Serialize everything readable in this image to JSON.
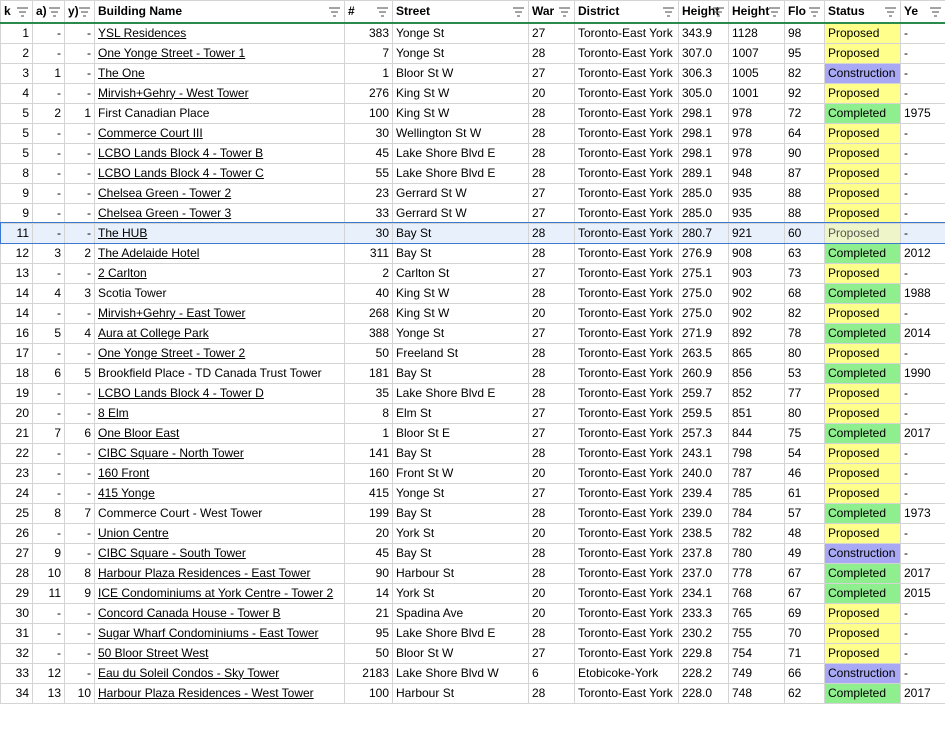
{
  "columns": [
    {
      "key": "rank",
      "label": "k"
    },
    {
      "key": "rank_a",
      "label": "a)"
    },
    {
      "key": "rank_b",
      "label": "y)"
    },
    {
      "key": "name",
      "label": "Building Name"
    },
    {
      "key": "num",
      "label": "#"
    },
    {
      "key": "street",
      "label": "Street"
    },
    {
      "key": "ward",
      "label": "War"
    },
    {
      "key": "district",
      "label": "District"
    },
    {
      "key": "height_m",
      "label": "Height"
    },
    {
      "key": "height_ft",
      "label": "Height"
    },
    {
      "key": "floors",
      "label": "Flo"
    },
    {
      "key": "status",
      "label": "Status"
    },
    {
      "key": "year",
      "label": "Ye"
    }
  ],
  "selected_row": 10,
  "rows": [
    {
      "rank": "1",
      "rank_a": "-",
      "rank_b": "-",
      "name": "YSL Residences",
      "link": true,
      "num": "383",
      "street": "Yonge St",
      "ward": "27",
      "district": "Toronto-East York",
      "height_m": "343.9",
      "height_ft": "1128",
      "floors": "98",
      "status": "Proposed",
      "year": "-"
    },
    {
      "rank": "2",
      "rank_a": "-",
      "rank_b": "-",
      "name": "One Yonge Street - Tower 1",
      "link": true,
      "num": "7",
      "street": "Yonge St",
      "ward": "28",
      "district": "Toronto-East York",
      "height_m": "307.0",
      "height_ft": "1007",
      "floors": "95",
      "status": "Proposed",
      "year": "-"
    },
    {
      "rank": "3",
      "rank_a": "1",
      "rank_b": "-",
      "name": "The One",
      "link": true,
      "num": "1",
      "street": "Bloor St W",
      "ward": "27",
      "district": "Toronto-East York",
      "height_m": "306.3",
      "height_ft": "1005",
      "floors": "82",
      "status": "Construction",
      "year": "-"
    },
    {
      "rank": "4",
      "rank_a": "-",
      "rank_b": "-",
      "name": "Mirvish+Gehry - West Tower",
      "link": true,
      "num": "276",
      "street": "King St W",
      "ward": "20",
      "district": "Toronto-East York",
      "height_m": "305.0",
      "height_ft": "1001",
      "floors": "92",
      "status": "Proposed",
      "year": "-"
    },
    {
      "rank": "5",
      "rank_a": "2",
      "rank_b": "1",
      "name": "First Canadian Place",
      "link": false,
      "num": "100",
      "street": "King St W",
      "ward": "28",
      "district": "Toronto-East York",
      "height_m": "298.1",
      "height_ft": "978",
      "floors": "72",
      "status": "Completed",
      "year": "1975"
    },
    {
      "rank": "5",
      "rank_a": "-",
      "rank_b": "-",
      "name": "Commerce Court III",
      "link": true,
      "num": "30",
      "street": "Wellington St W",
      "ward": "28",
      "district": "Toronto-East York",
      "height_m": "298.1",
      "height_ft": "978",
      "floors": "64",
      "status": "Proposed",
      "year": "-"
    },
    {
      "rank": "5",
      "rank_a": "-",
      "rank_b": "-",
      "name": "LCBO Lands Block 4 - Tower B",
      "link": true,
      "num": "45",
      "street": "Lake Shore Blvd E",
      "ward": "28",
      "district": "Toronto-East York",
      "height_m": "298.1",
      "height_ft": "978",
      "floors": "90",
      "status": "Proposed",
      "year": "-"
    },
    {
      "rank": "8",
      "rank_a": "-",
      "rank_b": "-",
      "name": "LCBO Lands Block 4 - Tower C",
      "link": true,
      "num": "55",
      "street": "Lake Shore Blvd E",
      "ward": "28",
      "district": "Toronto-East York",
      "height_m": "289.1",
      "height_ft": "948",
      "floors": "87",
      "status": "Proposed",
      "year": "-"
    },
    {
      "rank": "9",
      "rank_a": "-",
      "rank_b": "-",
      "name": "Chelsea Green - Tower 2",
      "link": true,
      "num": "23",
      "street": "Gerrard St W",
      "ward": "27",
      "district": "Toronto-East York",
      "height_m": "285.0",
      "height_ft": "935",
      "floors": "88",
      "status": "Proposed",
      "year": "-"
    },
    {
      "rank": "9",
      "rank_a": "-",
      "rank_b": "-",
      "name": "Chelsea Green - Tower 3",
      "link": true,
      "num": "33",
      "street": "Gerrard St W",
      "ward": "27",
      "district": "Toronto-East York",
      "height_m": "285.0",
      "height_ft": "935",
      "floors": "88",
      "status": "Proposed",
      "year": "-"
    },
    {
      "rank": "11",
      "rank_a": "-",
      "rank_b": "-",
      "name": "The HUB",
      "link": true,
      "num": "30",
      "street": "Bay St",
      "ward": "28",
      "district": "Toronto-East York",
      "height_m": "280.7",
      "height_ft": "921",
      "floors": "60",
      "status": "Proposed",
      "year": "-"
    },
    {
      "rank": "12",
      "rank_a": "3",
      "rank_b": "2",
      "name": "The Adelaide Hotel",
      "link": true,
      "num": "311",
      "street": "Bay St",
      "ward": "28",
      "district": "Toronto-East York",
      "height_m": "276.9",
      "height_ft": "908",
      "floors": "63",
      "status": "Completed",
      "year": "2012"
    },
    {
      "rank": "13",
      "rank_a": "-",
      "rank_b": "-",
      "name": "2 Carlton",
      "link": true,
      "num": "2",
      "street": "Carlton St",
      "ward": "27",
      "district": "Toronto-East York",
      "height_m": "275.1",
      "height_ft": "903",
      "floors": "73",
      "status": "Proposed",
      "year": "-"
    },
    {
      "rank": "14",
      "rank_a": "4",
      "rank_b": "3",
      "name": "Scotia Tower",
      "link": false,
      "num": "40",
      "street": "King St W",
      "ward": "28",
      "district": "Toronto-East York",
      "height_m": "275.0",
      "height_ft": "902",
      "floors": "68",
      "status": "Completed",
      "year": "1988"
    },
    {
      "rank": "14",
      "rank_a": "-",
      "rank_b": "-",
      "name": "Mirvish+Gehry - East Tower",
      "link": true,
      "num": "268",
      "street": "King St W",
      "ward": "20",
      "district": "Toronto-East York",
      "height_m": "275.0",
      "height_ft": "902",
      "floors": "82",
      "status": "Proposed",
      "year": "-"
    },
    {
      "rank": "16",
      "rank_a": "5",
      "rank_b": "4",
      "name": "Aura at College Park",
      "link": true,
      "num": "388",
      "street": "Yonge St",
      "ward": "27",
      "district": "Toronto-East York",
      "height_m": "271.9",
      "height_ft": "892",
      "floors": "78",
      "status": "Completed",
      "year": "2014"
    },
    {
      "rank": "17",
      "rank_a": "-",
      "rank_b": "-",
      "name": "One Yonge Street - Tower 2",
      "link": true,
      "num": "50",
      "street": "Freeland St",
      "ward": "28",
      "district": "Toronto-East York",
      "height_m": "263.5",
      "height_ft": "865",
      "floors": "80",
      "status": "Proposed",
      "year": "-"
    },
    {
      "rank": "18",
      "rank_a": "6",
      "rank_b": "5",
      "name": "Brookfield Place - TD Canada Trust Tower",
      "link": false,
      "num": "181",
      "street": "Bay St",
      "ward": "28",
      "district": "Toronto-East York",
      "height_m": "260.9",
      "height_ft": "856",
      "floors": "53",
      "status": "Completed",
      "year": "1990"
    },
    {
      "rank": "19",
      "rank_a": "-",
      "rank_b": "-",
      "name": "LCBO Lands Block 4 - Tower D",
      "link": true,
      "num": "35",
      "street": "Lake Shore Blvd E",
      "ward": "28",
      "district": "Toronto-East York",
      "height_m": "259.7",
      "height_ft": "852",
      "floors": "77",
      "status": "Proposed",
      "year": "-"
    },
    {
      "rank": "20",
      "rank_a": "-",
      "rank_b": "-",
      "name": "8 Elm",
      "link": true,
      "num": "8",
      "street": "Elm St",
      "ward": "27",
      "district": "Toronto-East York",
      "height_m": "259.5",
      "height_ft": "851",
      "floors": "80",
      "status": "Proposed",
      "year": "-"
    },
    {
      "rank": "21",
      "rank_a": "7",
      "rank_b": "6",
      "name": "One Bloor East",
      "link": true,
      "num": "1",
      "street": "Bloor St E",
      "ward": "27",
      "district": "Toronto-East York",
      "height_m": "257.3",
      "height_ft": "844",
      "floors": "75",
      "status": "Completed",
      "year": "2017"
    },
    {
      "rank": "22",
      "rank_a": "-",
      "rank_b": "-",
      "name": "CIBC Square - North Tower",
      "link": true,
      "num": "141",
      "street": "Bay St",
      "ward": "28",
      "district": "Toronto-East York",
      "height_m": "243.1",
      "height_ft": "798",
      "floors": "54",
      "status": "Proposed",
      "year": "-"
    },
    {
      "rank": "23",
      "rank_a": "-",
      "rank_b": "-",
      "name": "160 Front",
      "link": true,
      "num": "160",
      "street": "Front St W",
      "ward": "20",
      "district": "Toronto-East York",
      "height_m": "240.0",
      "height_ft": "787",
      "floors": "46",
      "status": "Proposed",
      "year": "-"
    },
    {
      "rank": "24",
      "rank_a": "-",
      "rank_b": "-",
      "name": "415 Yonge",
      "link": true,
      "num": "415",
      "street": "Yonge St",
      "ward": "27",
      "district": "Toronto-East York",
      "height_m": "239.4",
      "height_ft": "785",
      "floors": "61",
      "status": "Proposed",
      "year": "-"
    },
    {
      "rank": "25",
      "rank_a": "8",
      "rank_b": "7",
      "name": "Commerce Court - West Tower",
      "link": false,
      "num": "199",
      "street": "Bay St",
      "ward": "28",
      "district": "Toronto-East York",
      "height_m": "239.0",
      "height_ft": "784",
      "floors": "57",
      "status": "Completed",
      "year": "1973"
    },
    {
      "rank": "26",
      "rank_a": "-",
      "rank_b": "-",
      "name": "Union Centre",
      "link": true,
      "num": "20",
      "street": "York St",
      "ward": "20",
      "district": "Toronto-East York",
      "height_m": "238.5",
      "height_ft": "782",
      "floors": "48",
      "status": "Proposed",
      "year": "-"
    },
    {
      "rank": "27",
      "rank_a": "9",
      "rank_b": "-",
      "name": "CIBC Square - South Tower",
      "link": true,
      "num": "45",
      "street": "Bay St",
      "ward": "28",
      "district": "Toronto-East York",
      "height_m": "237.8",
      "height_ft": "780",
      "floors": "49",
      "status": "Construction",
      "year": "-"
    },
    {
      "rank": "28",
      "rank_a": "10",
      "rank_b": "8",
      "name": "Harbour Plaza Residences - East Tower",
      "link": true,
      "num": "90",
      "street": "Harbour St",
      "ward": "28",
      "district": "Toronto-East York",
      "height_m": "237.0",
      "height_ft": "778",
      "floors": "67",
      "status": "Completed",
      "year": "2017"
    },
    {
      "rank": "29",
      "rank_a": "11",
      "rank_b": "9",
      "name": "ICE Condominiums at York Centre - Tower 2",
      "link": true,
      "num": "14",
      "street": "York St",
      "ward": "20",
      "district": "Toronto-East York",
      "height_m": "234.1",
      "height_ft": "768",
      "floors": "67",
      "status": "Completed",
      "year": "2015"
    },
    {
      "rank": "30",
      "rank_a": "-",
      "rank_b": "-",
      "name": "Concord Canada House - Tower B",
      "link": true,
      "num": "21",
      "street": "Spadina Ave",
      "ward": "20",
      "district": "Toronto-East York",
      "height_m": "233.3",
      "height_ft": "765",
      "floors": "69",
      "status": "Proposed",
      "year": "-"
    },
    {
      "rank": "31",
      "rank_a": "-",
      "rank_b": "-",
      "name": "Sugar Wharf Condominiums - East Tower",
      "link": true,
      "num": "95",
      "street": "Lake Shore Blvd E",
      "ward": "28",
      "district": "Toronto-East York",
      "height_m": "230.2",
      "height_ft": "755",
      "floors": "70",
      "status": "Proposed",
      "year": "-"
    },
    {
      "rank": "32",
      "rank_a": "-",
      "rank_b": "-",
      "name": "50 Bloor Street West",
      "link": true,
      "num": "50",
      "street": "Bloor St W",
      "ward": "27",
      "district": "Toronto-East York",
      "height_m": "229.8",
      "height_ft": "754",
      "floors": "71",
      "status": "Proposed",
      "year": "-"
    },
    {
      "rank": "33",
      "rank_a": "12",
      "rank_b": "-",
      "name": "Eau du Soleil Condos - Sky Tower",
      "link": true,
      "num": "2183",
      "street": "Lake Shore Blvd W",
      "ward": "6",
      "district": "Etobicoke-York",
      "height_m": "228.2",
      "height_ft": "749",
      "floors": "66",
      "status": "Construction",
      "year": "-"
    },
    {
      "rank": "34",
      "rank_a": "13",
      "rank_b": "10",
      "name": "Harbour Plaza Residences - West Tower",
      "link": true,
      "num": "100",
      "street": "Harbour St",
      "ward": "28",
      "district": "Toronto-East York",
      "height_m": "228.0",
      "height_ft": "748",
      "floors": "62",
      "status": "Completed",
      "year": "2017"
    }
  ]
}
